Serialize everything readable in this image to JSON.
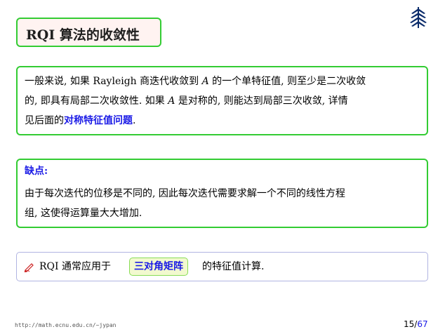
{
  "slide": {
    "title": "RQI 算法的收敛性",
    "logo_icon": "ecnu-logo-icon"
  },
  "block1": {
    "line1_pre": "一般来说, 如果 Rayleigh 商迭代收敛到 ",
    "line1_var": "A",
    "line1_post": " 的一个单特征值, 则至少是二次收敛",
    "line2_pre": "的, 即具有局部二次收敛性. 如果 ",
    "line2_var": "A",
    "line2_post": " 是对称的, 则能达到局部三次收敛, 详情",
    "line3_pre": "见后面的",
    "line3_link": "对称特征值问题",
    "line3_post": "."
  },
  "block2": {
    "heading": "缺点:",
    "line1": "由于每次迭代的位移是不同的, 因此每次迭代需要求解一个不同的线性方程",
    "line2": "组, 这使得运算量大大增加."
  },
  "note": {
    "icon": "pencil-icon",
    "text_pre": "RQI 通常应用于",
    "highlight": "三对角矩阵",
    "text_post": "的特征值计算."
  },
  "footer": {
    "url": "http://math.ecnu.edu.cn/~jypan",
    "page_current": "15",
    "page_sep": "/",
    "page_total": "67"
  },
  "colors": {
    "box_border": "#33cc33",
    "title_bg": "#fff3f1",
    "link": "#1a1ae6",
    "note_border": "#b0b4e2",
    "highlight_bg": "#f2f9cf"
  }
}
